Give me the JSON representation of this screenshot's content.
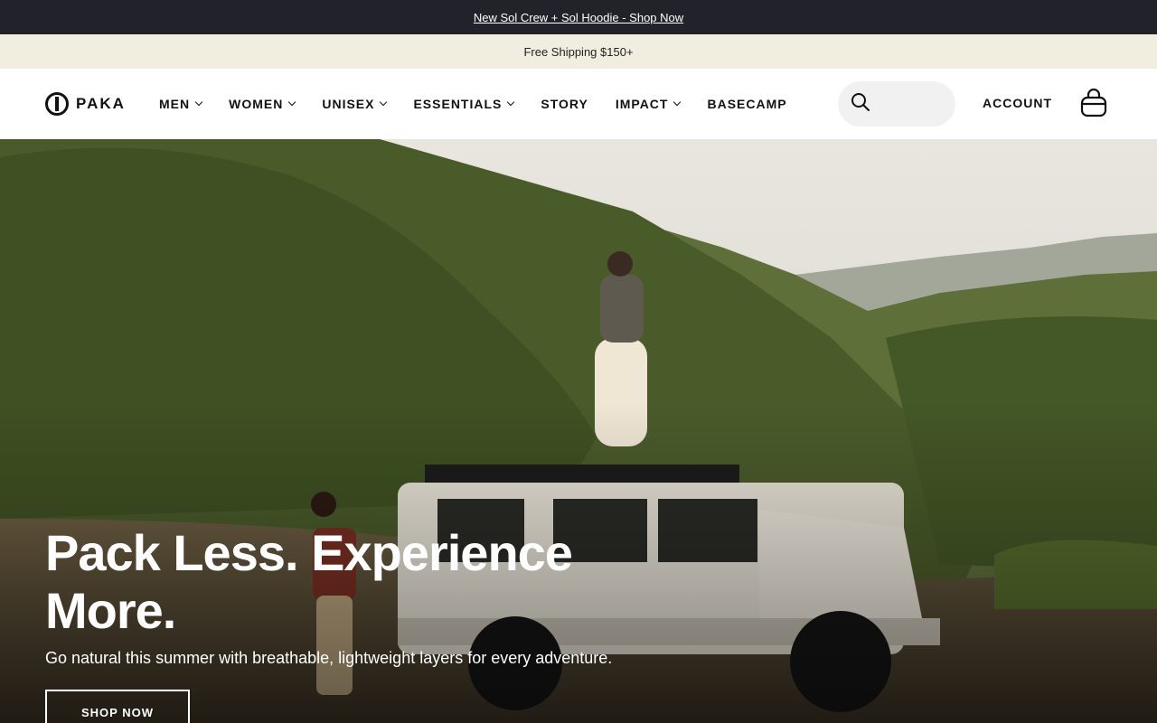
{
  "announcement": {
    "text": "New Sol Crew + Sol Hoodie - Shop Now"
  },
  "shipping": {
    "text": "Free Shipping $150+"
  },
  "header": {
    "logo_text": "PAKA",
    "menu": [
      {
        "label": "MEN",
        "has_dropdown": true
      },
      {
        "label": "WOMEN",
        "has_dropdown": true
      },
      {
        "label": "UNISEX",
        "has_dropdown": true
      },
      {
        "label": "ESSENTIALS",
        "has_dropdown": true
      },
      {
        "label": "STORY",
        "has_dropdown": false
      },
      {
        "label": "IMPACT",
        "has_dropdown": true
      },
      {
        "label": "BASECAMP",
        "has_dropdown": false
      }
    ],
    "search": {
      "value": "",
      "placeholder": ""
    },
    "account_label": "ACCOUNT",
    "cart_icon": "bag-icon"
  },
  "hero": {
    "title_line1": "Pack Less. Experience",
    "title_line2": "More.",
    "subtitle": "Go natural this summer with breathable, lightweight layers for every adventure.",
    "cta_label": "SHOP NOW"
  },
  "colors": {
    "announce_bg": "#22232a",
    "shipbar_bg": "#f1ede0",
    "search_bg": "#f1f1f1"
  }
}
